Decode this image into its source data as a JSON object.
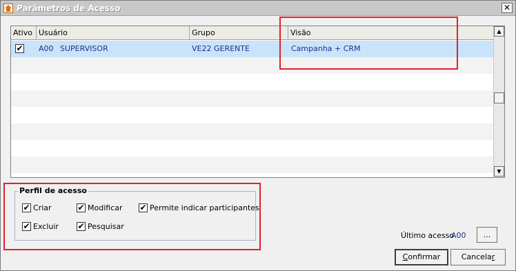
{
  "window": {
    "title": "Parâmetros de Acesso",
    "close_glyph": "✕"
  },
  "grid": {
    "columns": [
      "Ativo",
      "Usuário",
      "Grupo",
      "Visão"
    ],
    "rows": [
      {
        "ativo": true,
        "codigo": "A00",
        "usuario": "SUPERVISOR",
        "grupo": "VE22 GERENTE",
        "visao": "Campanha + CRM"
      }
    ]
  },
  "perfil": {
    "title": "Perfil de acesso",
    "options": {
      "criar": {
        "label": "Criar",
        "checked": true
      },
      "modificar": {
        "label": "Modificar",
        "checked": true
      },
      "permite": {
        "label": "Permite indicar participantes",
        "checked": true
      },
      "excluir": {
        "label": "Excluir",
        "checked": true
      },
      "pesquisar": {
        "label": "Pesquisar",
        "checked": true
      }
    }
  },
  "footer": {
    "ultimo_acesso_label": "Último acesso",
    "ultimo_acesso_value": "A00",
    "browse_label": "...",
    "confirm_first": "C",
    "confirm_rest": "onfirmar",
    "cancel_lead": "Cancela",
    "cancel_u": "r"
  },
  "icons": {
    "check": "✔",
    "scroll_up": "▲",
    "scroll_down": "▼"
  },
  "colors": {
    "highlight": "#e0202a",
    "selected_row": "#c9e3fb",
    "value_text": "#1c2f8a"
  }
}
